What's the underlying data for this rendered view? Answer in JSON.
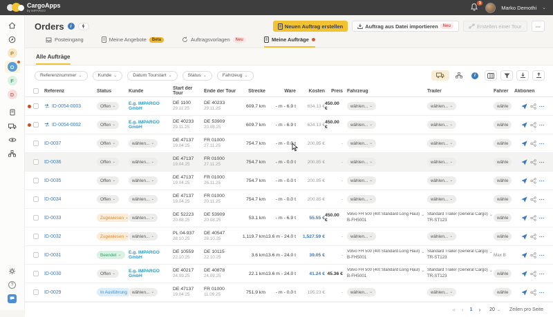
{
  "topbar": {
    "brand": "CargoApps",
    "brand_sub": "by IMPARGO",
    "notification_count": "3",
    "user_name": "Marko Demothi"
  },
  "page_title": "Orders",
  "header_actions": {
    "create_order": "Neuen Auftrag erstellen",
    "import_order": "Auftrag aus Datei importieren",
    "import_badge": "Neu",
    "create_tour": "Erstellen einer Tour",
    "more": "⋯"
  },
  "tabs": [
    {
      "label": "Posteingang"
    },
    {
      "label": "Meine Angebote",
      "badge": "Beta"
    },
    {
      "label": "Auftragsvorlagen",
      "badge": "Neu"
    },
    {
      "label": "Meine Aufträge",
      "active": true
    }
  ],
  "subtab": "Alle Aufträge",
  "filters": {
    "items": [
      "Referenznummer",
      "Kunde",
      "Datum Tourstart",
      "Status",
      "Fahrzeug"
    ]
  },
  "placeholders": {
    "select": "wählen...",
    "select_short": "wähle"
  },
  "colors": {
    "accent": "#f2c230",
    "link_blue": "#3a7abd",
    "customer_teal": "#2a9bc6",
    "alert_red": "#cf4a22"
  },
  "table": {
    "columns": [
      "Referenz",
      "Status",
      "Kunde",
      "Start der Tour",
      "Ende der Tour",
      "Strecke",
      "Ware",
      "Kosten",
      "Preis",
      "Fahrzeug",
      "Trailer",
      "Fahrer",
      "Aktionen"
    ],
    "rows": [
      {
        "alert": true,
        "arrow": true,
        "id": "ID-0054-0003",
        "status": "Offen",
        "status_type": "st-open",
        "customer_link": true,
        "customer": "E.g. IMPARGO GmbH",
        "start_loc": "DE 1100",
        "start_date": "29.11.25",
        "end_loc": "DE 40233",
        "end_date": "29.11.25",
        "distance": "609.7 km",
        "cargo": "- m - 6.9 t",
        "cost": "634.13 €",
        "cost_blue": false,
        "price": "450.00 €",
        "vehicle": null,
        "vehicle_plate": "",
        "trailer": null,
        "trailer_plate": "",
        "driver": null,
        "highlight": false
      },
      {
        "alert": true,
        "arrow": true,
        "id": "ID-0054-0002",
        "status": "Offen",
        "status_type": "st-open",
        "customer_link": true,
        "customer": "E.g. IMPARGO GmbH",
        "start_loc": "DE 40233",
        "start_date": "29.11.25",
        "end_loc": "DE 53909",
        "end_date": "20.08.25",
        "distance": "609.7 km",
        "cargo": "- m - 6.9 t",
        "cost": "634.13 €",
        "cost_blue": false,
        "price": "450.00 €",
        "vehicle": null,
        "vehicle_plate": "",
        "trailer": null,
        "trailer_plate": "",
        "driver": null,
        "highlight": false
      },
      {
        "alert": false,
        "arrow": false,
        "id": "ID-0037",
        "status": "Offen",
        "status_type": "st-open",
        "customer_link": false,
        "customer": "wählen...",
        "start_loc": "DE 47137",
        "start_date": "19.04.25",
        "end_loc": "FR 01000",
        "end_date": "27.11.25",
        "distance": "754.7 km",
        "cargo": "- m - 0.0 t",
        "cost": "200.85 €",
        "cost_blue": false,
        "price": "-",
        "vehicle": null,
        "vehicle_plate": "",
        "trailer": null,
        "trailer_plate": "",
        "driver": null,
        "highlight": false
      },
      {
        "alert": false,
        "arrow": false,
        "id": "ID-0036",
        "status": "Offen",
        "status_type": "st-open",
        "customer_link": false,
        "customer": "wählen...",
        "start_loc": "DE 47137",
        "start_date": "19.04.25",
        "end_loc": "FR 01000",
        "end_date": "27.11.25",
        "distance": "754.7 km",
        "cargo": "- m - 0.0 t",
        "cost": "200.85 €",
        "cost_blue": false,
        "price": "-",
        "vehicle": null,
        "vehicle_plate": "",
        "trailer": null,
        "trailer_plate": "",
        "driver": null,
        "highlight": true
      },
      {
        "alert": false,
        "arrow": false,
        "id": "ID-0035",
        "status": "Offen",
        "status_type": "st-open",
        "customer_link": false,
        "customer": "wählen...",
        "start_loc": "DE 47137",
        "start_date": "19.04.25",
        "end_loc": "FR 01000",
        "end_date": "26.11.25",
        "distance": "754.7 km",
        "cargo": "- m - 0.0 t",
        "cost": "200.85 €",
        "cost_blue": false,
        "price": "-",
        "vehicle": null,
        "vehicle_plate": "",
        "trailer": null,
        "trailer_plate": "",
        "driver": null,
        "highlight": false
      },
      {
        "alert": false,
        "arrow": false,
        "id": "ID-0034",
        "status": "Offen",
        "status_type": "st-open",
        "customer_link": false,
        "customer": "wählen...",
        "start_loc": "DE 47137",
        "start_date": "19.04.25",
        "end_loc": "FR 01000",
        "end_date": "20.11.25",
        "distance": "754.7 km",
        "cargo": "- m - 0.0 t",
        "cost": "200.85 €",
        "cost_blue": false,
        "price": "-",
        "vehicle": null,
        "vehicle_plate": "",
        "trailer": null,
        "trailer_plate": "",
        "driver": null,
        "highlight": false
      },
      {
        "alert": false,
        "arrow": false,
        "id": "ID-0033",
        "status": "Zugewiesen",
        "status_type": "st-assigned",
        "customer_link": false,
        "customer": "wählen...",
        "start_loc": "DE 52223",
        "start_date": "20.08.25",
        "end_loc": "DE 53909",
        "end_date": "20.08.25",
        "distance": "53.1 km",
        "cargo": "- m - 6.9 t",
        "cost": "55.55 €",
        "cost_blue": true,
        "price": "450.00 €",
        "vehicle": "Volvo FH 500 (40t Standard Long Haul)",
        "vehicle_plate": "B-FH5001",
        "trailer": "Standard Trailer (General Cargo)",
        "trailer_plate": "TR-ST123",
        "driver": null,
        "highlight": false
      },
      {
        "alert": false,
        "arrow": false,
        "id": "ID-0032",
        "status": "Zugewiesen",
        "status_type": "st-assigned",
        "customer_link": false,
        "customer": "wählen...",
        "start_loc": "PL 04-937",
        "start_date": "28.10.25",
        "end_loc": "DE 40547",
        "end_date": "28.10.25",
        "distance": "1,119.7 km",
        "cargo": "13.6 m - 24.0 t",
        "cost": "1,527.59 €",
        "cost_blue": true,
        "price": "-",
        "vehicle": null,
        "vehicle_plate": "",
        "trailer": null,
        "trailer_plate": "",
        "driver": null,
        "highlight": false
      },
      {
        "alert": false,
        "arrow": false,
        "id": "ID-0031",
        "status": "Beendet",
        "status_type": "st-done",
        "customer_link": true,
        "customer": "E.g. IMPARGO GmbH",
        "start_loc": "DE 10559",
        "start_date": "22.10.25",
        "end_loc": "DE 10115",
        "end_date": "22.10.25",
        "distance": "3.6 km",
        "cargo": "13.6 m - 24.0 t",
        "cost": "39.05 €",
        "cost_blue": true,
        "price": "-",
        "vehicle": "Volvo FH 500 (40t Standard Long Haul)",
        "vehicle_plate": "B-FH5001",
        "trailer": "Standard Trailer (General Cargo)",
        "trailer_plate": "TR-ST123",
        "driver": "Max B",
        "highlight": false
      },
      {
        "alert": false,
        "arrow": false,
        "id": "ID-0030",
        "status": "Offen",
        "status_type": "st-open",
        "customer_link": true,
        "customer": "E.g. IMPARGO GmbH",
        "start_loc": "DE 40217",
        "start_date": "24.09.25",
        "end_loc": "DE 40878",
        "end_date": "24.09.25",
        "distance": "22.1 km",
        "cargo": "13.6 m - 24.0 t",
        "cost": "41.24 €",
        "cost_blue": true,
        "price": "45.36 €",
        "vehicle": "Volvo FH 500 (40t Standard Long Haul)",
        "vehicle_plate": "B-FH5001",
        "trailer": "Standard Trailer (General Cargo)",
        "trailer_plate": "TR-ST123",
        "driver": null,
        "highlight": false
      },
      {
        "alert": false,
        "arrow": false,
        "id": "ID-0029",
        "status": "In Ausführung",
        "status_type": "st-progress",
        "customer_link": false,
        "customer": "wählen...",
        "start_loc": "DE 47137",
        "start_date": "19.04.25",
        "end_loc": "FR 01000",
        "end_date": "11.09.25",
        "distance": "751.9 km",
        "cargo": "- m - 0.0 t",
        "cost": "195.23 €",
        "cost_blue": false,
        "price": "-",
        "vehicle": null,
        "vehicle_plate": "",
        "trailer": null,
        "trailer_plate": "",
        "driver": null,
        "highlight": false
      }
    ]
  },
  "pagination": {
    "first": "«",
    "prev": "‹",
    "page": "1",
    "next": "›",
    "page_size": "20",
    "rows_label": "Zeilen pro Seite"
  }
}
